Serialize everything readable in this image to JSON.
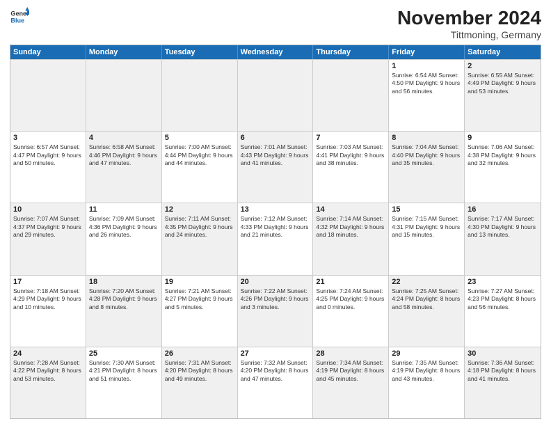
{
  "header": {
    "logo_line1": "General",
    "logo_line2": "Blue",
    "month_title": "November 2024",
    "location": "Tittmoning, Germany"
  },
  "days_of_week": [
    "Sunday",
    "Monday",
    "Tuesday",
    "Wednesday",
    "Thursday",
    "Friday",
    "Saturday"
  ],
  "rows": [
    [
      {
        "day": "",
        "info": "",
        "shaded": true
      },
      {
        "day": "",
        "info": "",
        "shaded": true
      },
      {
        "day": "",
        "info": "",
        "shaded": true
      },
      {
        "day": "",
        "info": "",
        "shaded": true
      },
      {
        "day": "",
        "info": "",
        "shaded": true
      },
      {
        "day": "1",
        "info": "Sunrise: 6:54 AM\nSunset: 4:50 PM\nDaylight: 9 hours and 56 minutes."
      },
      {
        "day": "2",
        "info": "Sunrise: 6:55 AM\nSunset: 4:49 PM\nDaylight: 9 hours and 53 minutes.",
        "shaded": true
      }
    ],
    [
      {
        "day": "3",
        "info": "Sunrise: 6:57 AM\nSunset: 4:47 PM\nDaylight: 9 hours and 50 minutes."
      },
      {
        "day": "4",
        "info": "Sunrise: 6:58 AM\nSunset: 4:46 PM\nDaylight: 9 hours and 47 minutes.",
        "shaded": true
      },
      {
        "day": "5",
        "info": "Sunrise: 7:00 AM\nSunset: 4:44 PM\nDaylight: 9 hours and 44 minutes."
      },
      {
        "day": "6",
        "info": "Sunrise: 7:01 AM\nSunset: 4:43 PM\nDaylight: 9 hours and 41 minutes.",
        "shaded": true
      },
      {
        "day": "7",
        "info": "Sunrise: 7:03 AM\nSunset: 4:41 PM\nDaylight: 9 hours and 38 minutes."
      },
      {
        "day": "8",
        "info": "Sunrise: 7:04 AM\nSunset: 4:40 PM\nDaylight: 9 hours and 35 minutes.",
        "shaded": true
      },
      {
        "day": "9",
        "info": "Sunrise: 7:06 AM\nSunset: 4:38 PM\nDaylight: 9 hours and 32 minutes."
      }
    ],
    [
      {
        "day": "10",
        "info": "Sunrise: 7:07 AM\nSunset: 4:37 PM\nDaylight: 9 hours and 29 minutes.",
        "shaded": true
      },
      {
        "day": "11",
        "info": "Sunrise: 7:09 AM\nSunset: 4:36 PM\nDaylight: 9 hours and 26 minutes."
      },
      {
        "day": "12",
        "info": "Sunrise: 7:11 AM\nSunset: 4:35 PM\nDaylight: 9 hours and 24 minutes.",
        "shaded": true
      },
      {
        "day": "13",
        "info": "Sunrise: 7:12 AM\nSunset: 4:33 PM\nDaylight: 9 hours and 21 minutes."
      },
      {
        "day": "14",
        "info": "Sunrise: 7:14 AM\nSunset: 4:32 PM\nDaylight: 9 hours and 18 minutes.",
        "shaded": true
      },
      {
        "day": "15",
        "info": "Sunrise: 7:15 AM\nSunset: 4:31 PM\nDaylight: 9 hours and 15 minutes."
      },
      {
        "day": "16",
        "info": "Sunrise: 7:17 AM\nSunset: 4:30 PM\nDaylight: 9 hours and 13 minutes.",
        "shaded": true
      }
    ],
    [
      {
        "day": "17",
        "info": "Sunrise: 7:18 AM\nSunset: 4:29 PM\nDaylight: 9 hours and 10 minutes."
      },
      {
        "day": "18",
        "info": "Sunrise: 7:20 AM\nSunset: 4:28 PM\nDaylight: 9 hours and 8 minutes.",
        "shaded": true
      },
      {
        "day": "19",
        "info": "Sunrise: 7:21 AM\nSunset: 4:27 PM\nDaylight: 9 hours and 5 minutes."
      },
      {
        "day": "20",
        "info": "Sunrise: 7:22 AM\nSunset: 4:26 PM\nDaylight: 9 hours and 3 minutes.",
        "shaded": true
      },
      {
        "day": "21",
        "info": "Sunrise: 7:24 AM\nSunset: 4:25 PM\nDaylight: 9 hours and 0 minutes."
      },
      {
        "day": "22",
        "info": "Sunrise: 7:25 AM\nSunset: 4:24 PM\nDaylight: 8 hours and 58 minutes.",
        "shaded": true
      },
      {
        "day": "23",
        "info": "Sunrise: 7:27 AM\nSunset: 4:23 PM\nDaylight: 8 hours and 56 minutes."
      }
    ],
    [
      {
        "day": "24",
        "info": "Sunrise: 7:28 AM\nSunset: 4:22 PM\nDaylight: 8 hours and 53 minutes.",
        "shaded": true
      },
      {
        "day": "25",
        "info": "Sunrise: 7:30 AM\nSunset: 4:21 PM\nDaylight: 8 hours and 51 minutes."
      },
      {
        "day": "26",
        "info": "Sunrise: 7:31 AM\nSunset: 4:20 PM\nDaylight: 8 hours and 49 minutes.",
        "shaded": true
      },
      {
        "day": "27",
        "info": "Sunrise: 7:32 AM\nSunset: 4:20 PM\nDaylight: 8 hours and 47 minutes."
      },
      {
        "day": "28",
        "info": "Sunrise: 7:34 AM\nSunset: 4:19 PM\nDaylight: 8 hours and 45 minutes.",
        "shaded": true
      },
      {
        "day": "29",
        "info": "Sunrise: 7:35 AM\nSunset: 4:19 PM\nDaylight: 8 hours and 43 minutes."
      },
      {
        "day": "30",
        "info": "Sunrise: 7:36 AM\nSunset: 4:18 PM\nDaylight: 8 hours and 41 minutes.",
        "shaded": true
      }
    ]
  ]
}
